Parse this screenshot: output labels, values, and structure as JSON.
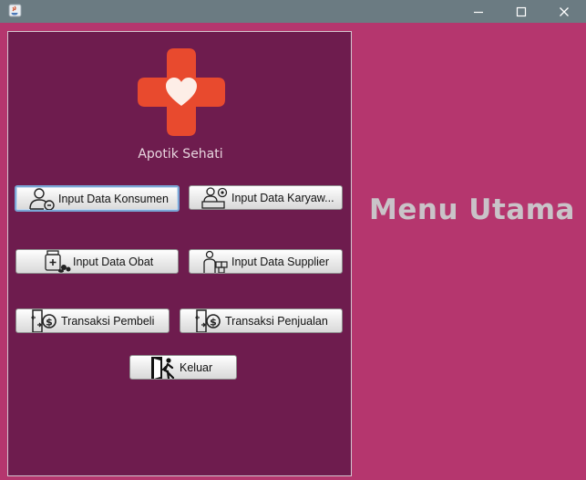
{
  "window": {
    "minimize_symbol": "—",
    "maximize_symbol": "☐",
    "close_symbol": "✕"
  },
  "sidebar": {
    "app_name": "Apotik Sehati",
    "logo_icon": "medical-cross-heart-icon",
    "buttons": [
      {
        "label": "Input Data Konsumen",
        "icon": "customer-icon"
      },
      {
        "label": "Input Data Karyaw...",
        "icon": "employee-icon"
      },
      {
        "label": "Input Data Obat",
        "icon": "medicine-icon"
      },
      {
        "label": "Input Data Supplier",
        "icon": "supplier-icon"
      },
      {
        "label": "Transaksi Pembeli",
        "icon": "money-transfer-icon"
      },
      {
        "label": "Transaksi Penjualan",
        "icon": "money-transfer-icon"
      },
      {
        "label": "Keluar",
        "icon": "exit-door-icon"
      }
    ]
  },
  "main": {
    "headline": "Menu Utama"
  },
  "colors": {
    "titlebar": "#6b7b82",
    "background": "#b5366e",
    "panel": "#6e1c4e",
    "logo_red": "#e84a2e",
    "headline_text": "#c9c3c8"
  }
}
